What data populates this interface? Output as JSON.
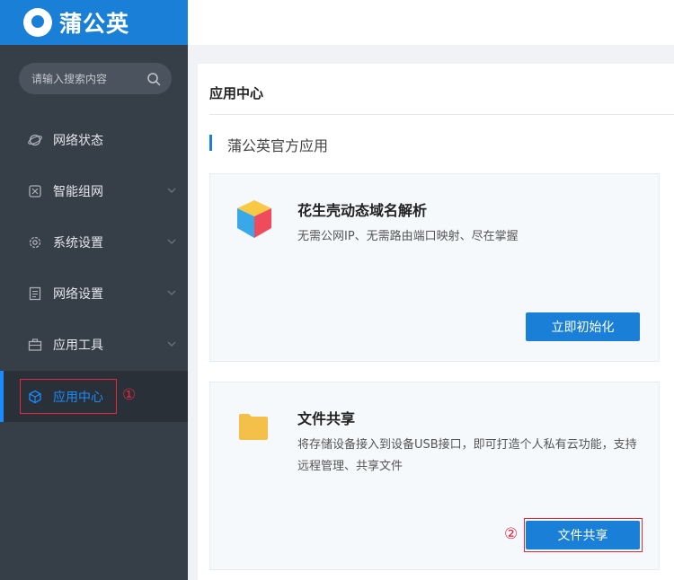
{
  "brand": {
    "name": "蒲公英"
  },
  "sidebar": {
    "search_placeholder": "请输入搜索内容",
    "items": [
      {
        "label": "网络状态",
        "icon": "globe-icon",
        "has_submenu": false
      },
      {
        "label": "智能组网",
        "icon": "network-icon",
        "has_submenu": true
      },
      {
        "label": "系统设置",
        "icon": "gear-icon",
        "has_submenu": true
      },
      {
        "label": "网络设置",
        "icon": "document-icon",
        "has_submenu": true
      },
      {
        "label": "应用工具",
        "icon": "toolbox-icon",
        "has_submenu": true
      },
      {
        "label": "应用中心",
        "icon": "cube-icon",
        "has_submenu": false,
        "active": true
      }
    ]
  },
  "annotations": {
    "step1": "①",
    "step2": "②"
  },
  "main": {
    "title": "应用中心",
    "section_title": "蒲公英官方应用",
    "apps": [
      {
        "title": "花生壳动态域名解析",
        "description": "无需公网IP、无需路由端口映射、尽在掌握",
        "button": "立即初始化",
        "icon": "peanut-shell-cube-icon"
      },
      {
        "title": "文件共享",
        "description": "将存储设备接入到设备USB接口，即可打造个人私有云功能，支持远程管理、共享文件",
        "button": "文件共享",
        "icon": "folder-icon"
      }
    ]
  },
  "colors": {
    "brand_blue": "#1a7fd6",
    "sidebar_bg": "#363e48",
    "active_blue": "#1a8cff",
    "annotation_red": "#e3283f"
  }
}
